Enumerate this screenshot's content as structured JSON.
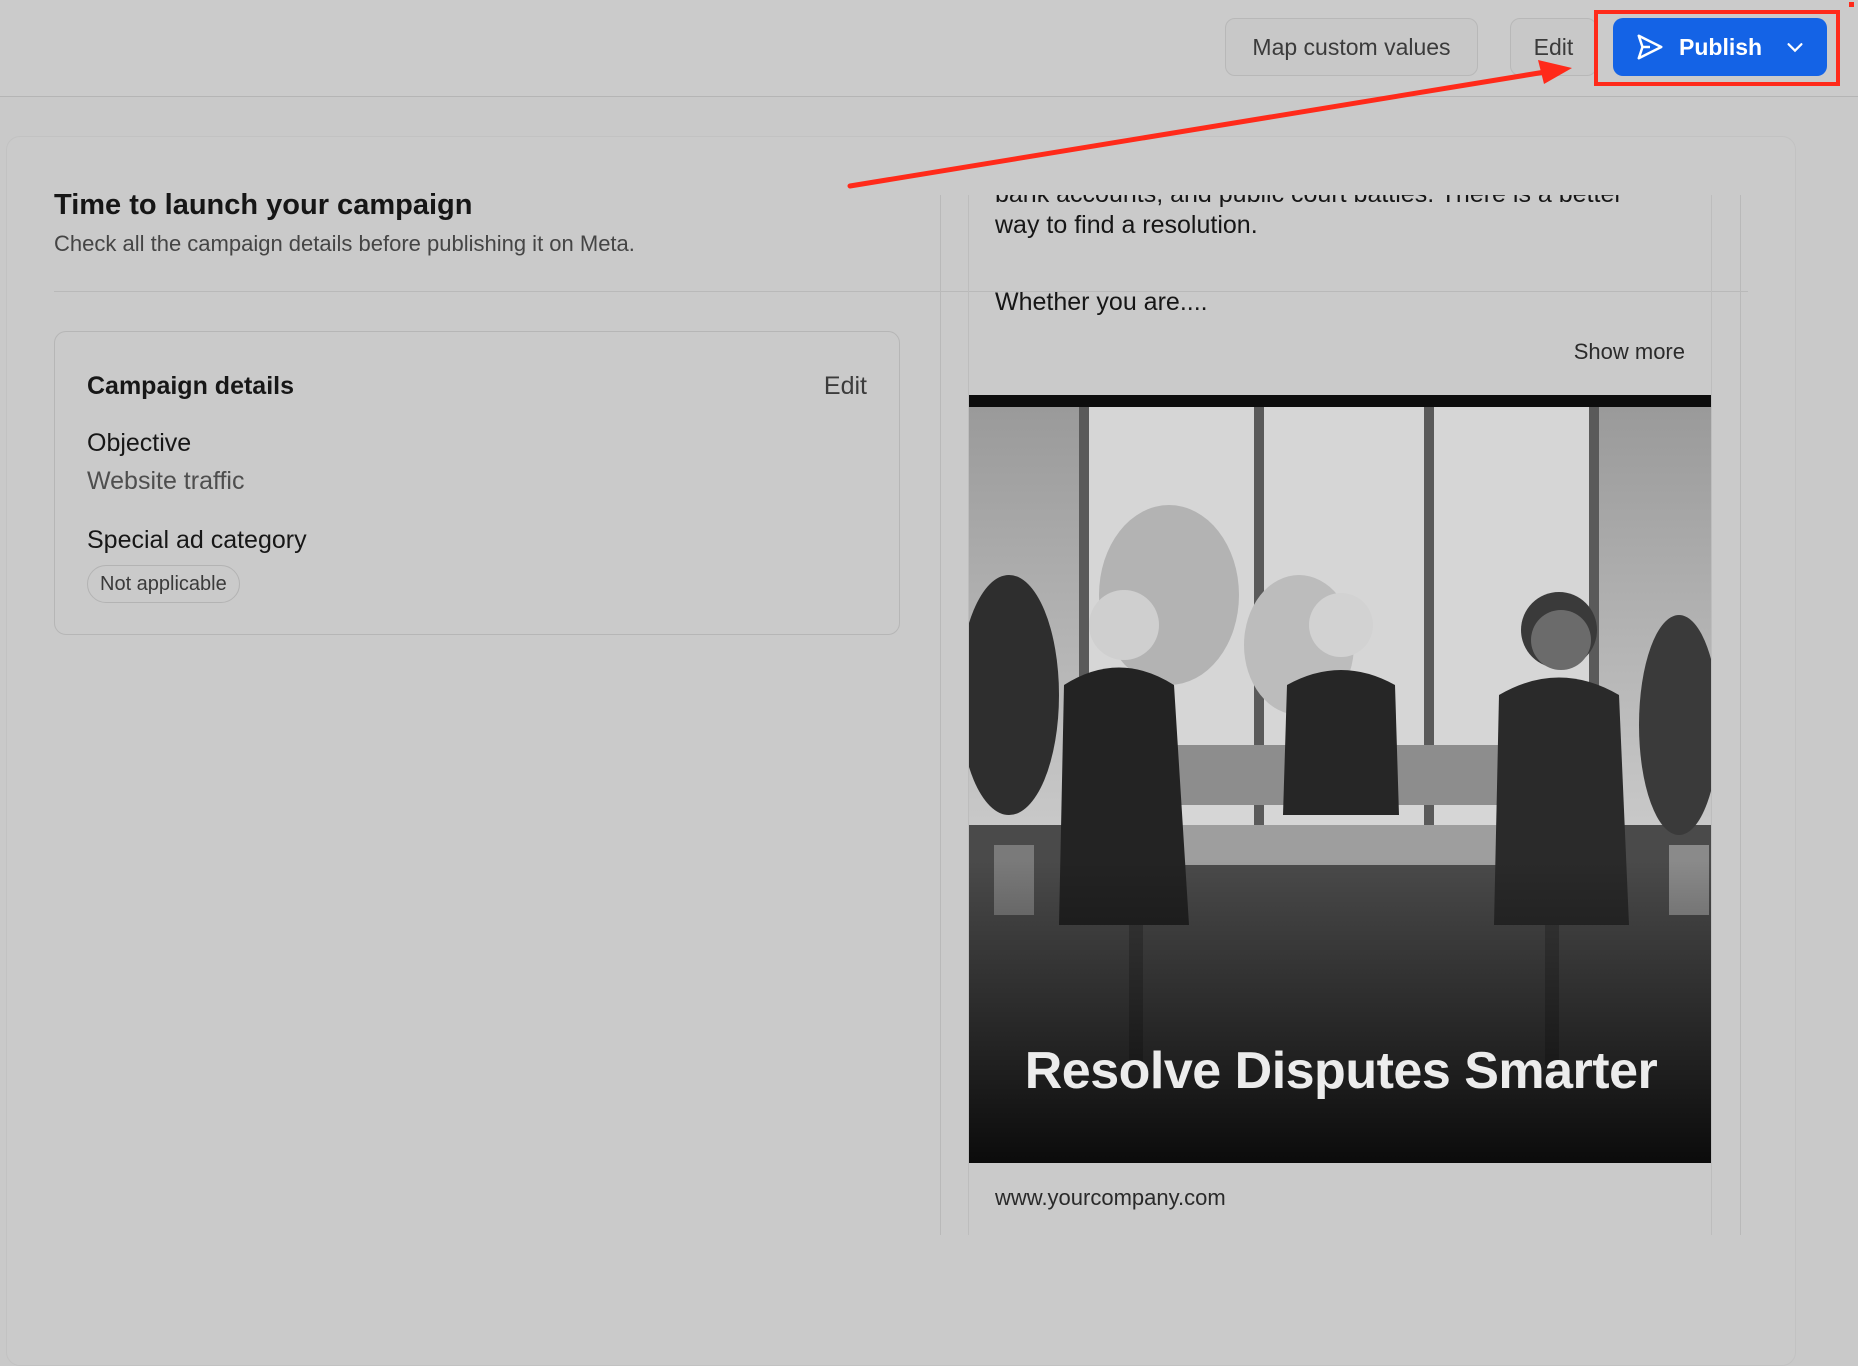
{
  "toolbar": {
    "map_label": "Map custom values",
    "edit_label": "Edit",
    "publish_label": "Publish",
    "publish_icon": "send-icon",
    "publish_menu_icon": "chevron-down-icon",
    "accent_color": "#1463e6",
    "highlight_color": "#ff2a1a"
  },
  "header": {
    "title": "Time to launch your campaign",
    "subtitle": "Check all the campaign details before publishing it on Meta."
  },
  "details": {
    "title": "Campaign details",
    "edit_label": "Edit",
    "objective_label": "Objective",
    "objective_value": "Website traffic",
    "category_label": "Special ad category",
    "category_value": "Not applicable"
  },
  "preview": {
    "text_clipped": "bank accounts, and public court battles. There is a better",
    "text_line2": "way to find a resolution.",
    "text_line3": "Whether you are....",
    "show_more": "Show more",
    "image_caption": "Resolve Disputes Smarter",
    "url": "www.yourcompany.com"
  }
}
